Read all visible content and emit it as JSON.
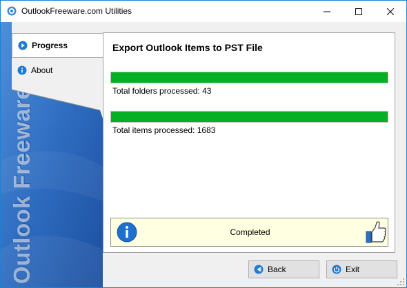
{
  "window": {
    "title": "OutlookFreeware.com Utilities",
    "accent_color": "#1883d7"
  },
  "sidebar": {
    "watermark": "Outlook Freeware .com",
    "background_color": "#2f6fc0",
    "items": [
      {
        "label": "Progress",
        "icon": "play-circle-icon",
        "active": true
      },
      {
        "label": "About",
        "icon": "info-circle-icon",
        "active": false
      }
    ]
  },
  "main": {
    "heading": "Export Outlook Items to PST File",
    "progress": [
      {
        "label": "Total folders processed: 43",
        "fraction": 1.0,
        "color": "#06b025"
      },
      {
        "label": "Total items processed: 1683",
        "fraction": 1.0,
        "color": "#06b025"
      }
    ],
    "status": {
      "text": "Completed",
      "icon": "info-circle-icon",
      "badge_icon": "thumbs-up-icon",
      "background_color": "#ffffe1"
    }
  },
  "buttons": {
    "back_label": "Back",
    "exit_label": "Exit"
  }
}
